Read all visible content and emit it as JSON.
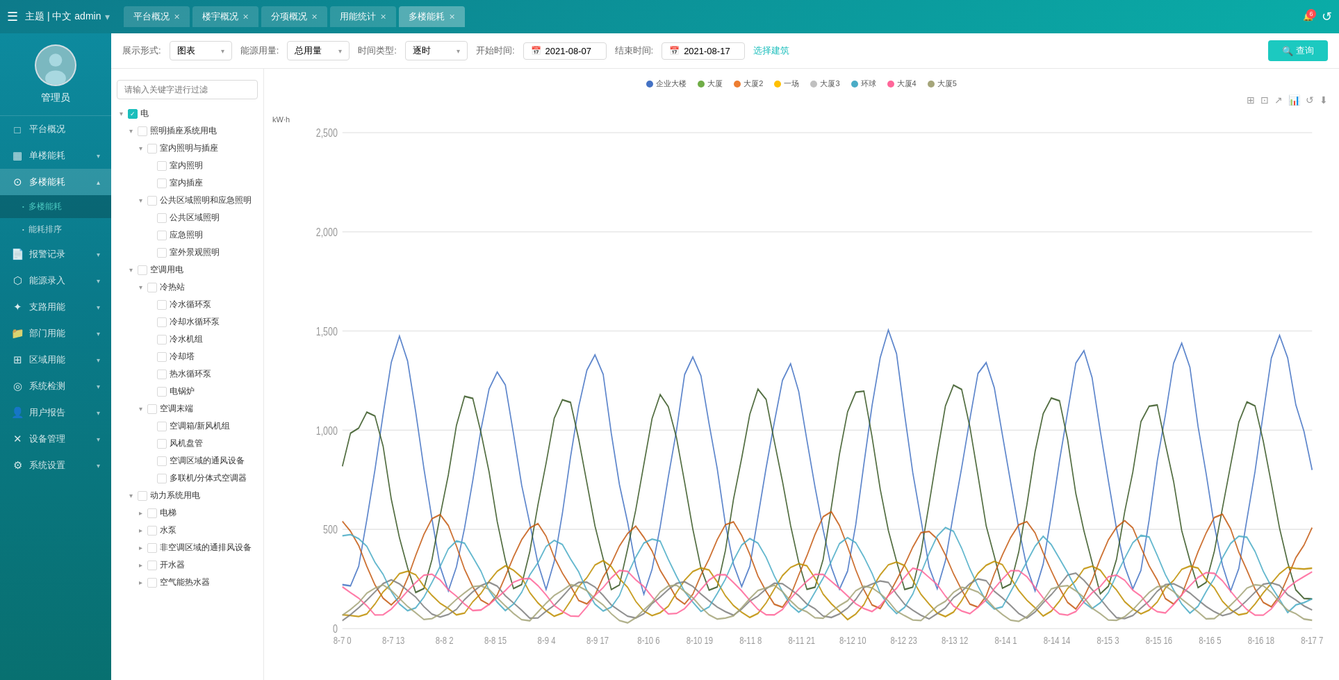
{
  "topNav": {
    "menuIcon": "☰",
    "brand": "主题 | 中文  admin",
    "tabs": [
      {
        "label": "平台概况",
        "active": false
      },
      {
        "label": "楼宇概况",
        "active": false
      },
      {
        "label": "分项概况",
        "active": false
      },
      {
        "label": "用能统计",
        "active": false
      },
      {
        "label": "多楼能耗",
        "active": true
      }
    ],
    "bellCount": "6",
    "refreshIcon": "↺"
  },
  "filters": {
    "displayLabel": "展示形式:",
    "displayValue": "图表",
    "energyLabel": "能源用量:",
    "energyValue": "总用量",
    "timeTypeLabel": "时间类型:",
    "timeTypeValue": "逐时",
    "startLabel": "开始时间:",
    "startDate": "2021-08-07",
    "endLabel": "结束时间:",
    "endDate": "2021-08-17",
    "buildingLink": "选择建筑",
    "queryBtn": "查询",
    "searchIcon": "🔍"
  },
  "sidebar": {
    "username": "管理员",
    "items": [
      {
        "icon": "□",
        "label": "平台概况",
        "hasArrow": false
      },
      {
        "icon": "▦",
        "label": "单楼能耗",
        "hasArrow": true
      },
      {
        "icon": "⊙",
        "label": "多楼能耗",
        "hasArrow": true,
        "active": true,
        "subs": [
          {
            "label": "多楼能耗",
            "active": true
          },
          {
            "label": "能耗排序",
            "active": false
          }
        ]
      },
      {
        "icon": "📄",
        "label": "报警记录",
        "hasArrow": true
      },
      {
        "icon": "⬡",
        "label": "能源录入",
        "hasArrow": true
      },
      {
        "icon": "✦",
        "label": "支路用能",
        "hasArrow": true
      },
      {
        "icon": "📁",
        "label": "部门用能",
        "hasArrow": true
      },
      {
        "icon": "⊞",
        "label": "区域用能",
        "hasArrow": true
      },
      {
        "icon": "◎",
        "label": "系统检测",
        "hasArrow": true
      },
      {
        "icon": "👤",
        "label": "用户报告",
        "hasArrow": true
      },
      {
        "icon": "✕",
        "label": "设备管理",
        "hasArrow": true
      },
      {
        "icon": "⚙",
        "label": "系统设置",
        "hasArrow": true
      }
    ]
  },
  "tree": {
    "searchPlaceholder": "请输入关键字进行过滤",
    "nodes": [
      {
        "level": 0,
        "expand": true,
        "checked": true,
        "half": false,
        "label": "电"
      },
      {
        "level": 1,
        "expand": true,
        "checked": false,
        "half": false,
        "label": "照明插座系统用电"
      },
      {
        "level": 2,
        "expand": true,
        "checked": false,
        "half": false,
        "label": "室内照明与插座"
      },
      {
        "level": 3,
        "expand": false,
        "checked": false,
        "half": false,
        "label": "室内照明"
      },
      {
        "level": 3,
        "expand": false,
        "checked": false,
        "half": false,
        "label": "室内插座"
      },
      {
        "level": 2,
        "expand": true,
        "checked": false,
        "half": false,
        "label": "公共区域照明和应急照明"
      },
      {
        "level": 3,
        "expand": false,
        "checked": false,
        "half": false,
        "label": "公共区域照明"
      },
      {
        "level": 3,
        "expand": false,
        "checked": false,
        "half": false,
        "label": "应急照明"
      },
      {
        "level": 3,
        "expand": false,
        "checked": false,
        "half": false,
        "label": "室外景观照明"
      },
      {
        "level": 1,
        "expand": true,
        "checked": false,
        "half": false,
        "label": "空调用电"
      },
      {
        "level": 2,
        "expand": true,
        "checked": false,
        "half": false,
        "label": "冷热站"
      },
      {
        "level": 3,
        "expand": false,
        "checked": false,
        "half": false,
        "label": "冷水循环泵"
      },
      {
        "level": 3,
        "expand": false,
        "checked": false,
        "half": false,
        "label": "冷却水循环泵"
      },
      {
        "level": 3,
        "expand": false,
        "checked": false,
        "half": false,
        "label": "冷水机组"
      },
      {
        "level": 3,
        "expand": false,
        "checked": false,
        "half": false,
        "label": "冷却塔"
      },
      {
        "level": 3,
        "expand": false,
        "checked": false,
        "half": false,
        "label": "热水循环泵"
      },
      {
        "level": 3,
        "expand": false,
        "checked": false,
        "half": false,
        "label": "电锅炉"
      },
      {
        "level": 2,
        "expand": true,
        "checked": false,
        "half": false,
        "label": "空调末端"
      },
      {
        "level": 3,
        "expand": false,
        "checked": false,
        "half": false,
        "label": "空调箱/新风机组"
      },
      {
        "level": 3,
        "expand": false,
        "checked": false,
        "half": false,
        "label": "风机盘管"
      },
      {
        "level": 3,
        "expand": false,
        "checked": false,
        "half": false,
        "label": "空调区域的通风设备"
      },
      {
        "level": 3,
        "expand": false,
        "checked": false,
        "half": false,
        "label": "多联机/分体式空调器"
      },
      {
        "level": 1,
        "expand": true,
        "checked": false,
        "half": false,
        "label": "动力系统用电"
      },
      {
        "level": 2,
        "expand": false,
        "checked": false,
        "half": false,
        "label": "电梯"
      },
      {
        "level": 2,
        "expand": false,
        "checked": false,
        "half": false,
        "label": "水泵"
      },
      {
        "level": 2,
        "expand": false,
        "checked": false,
        "half": false,
        "label": "非空调区域的通排风设备"
      },
      {
        "level": 2,
        "expand": false,
        "checked": false,
        "half": false,
        "label": "开水器"
      },
      {
        "level": 2,
        "expand": false,
        "checked": false,
        "half": false,
        "label": "空气能热水器"
      }
    ]
  },
  "chart": {
    "yLabel": "kW·h",
    "yMax": 2500,
    "ySteps": [
      0,
      500,
      1000,
      1500,
      2000,
      2500
    ],
    "xLabels": [
      "8-7 0",
      "8-7 13",
      "8-8 2",
      "8-8 15",
      "8-9 4",
      "8-9 17",
      "8-10 6",
      "8-10 19",
      "8-11 8",
      "8-11 21",
      "8-12 10",
      "8-12 23",
      "8-13 12",
      "8-14 1",
      "8-14 14",
      "8-15 3",
      "8-15 16",
      "8-16 5",
      "8-16 18",
      "8-17 7"
    ],
    "legends": [
      {
        "label": "企业大楼",
        "color": "#4472c4"
      },
      {
        "label": "大厦",
        "color": "#70ad47"
      },
      {
        "label": "大厦2",
        "color": "#ed7d31"
      },
      {
        "label": "一场",
        "color": "#ffc000"
      },
      {
        "label": "大厦3",
        "color": "#c0c0c0"
      },
      {
        "label": "环球",
        "color": "#4bacc6"
      },
      {
        "label": "大厦4",
        "color": "#ff6699"
      },
      {
        "label": "大厦5",
        "color": "#a5a57a"
      }
    ],
    "toolbarIcons": [
      "⊞",
      "⊡",
      "↗",
      "📊",
      "↺",
      "⬇"
    ]
  }
}
